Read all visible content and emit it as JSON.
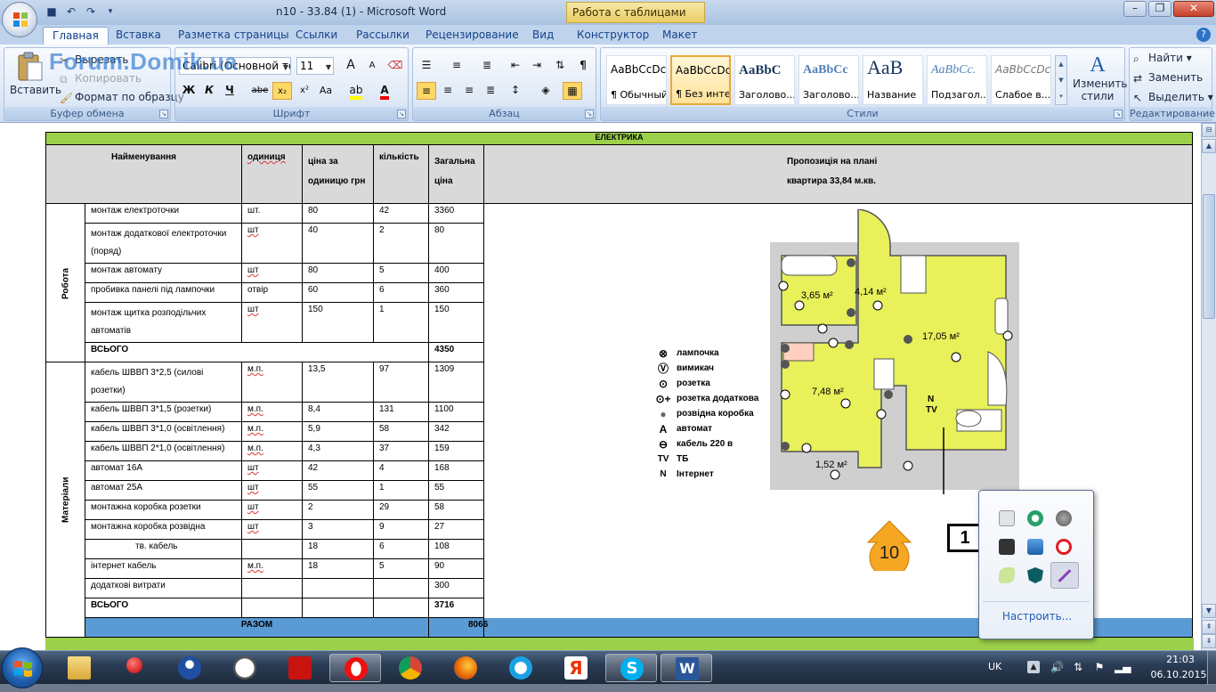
{
  "window": {
    "title": "n10 - 33.84 (1) - Microsoft Word",
    "context_tab": "Работа с таблицами"
  },
  "ribbon_tabs": [
    "Главная",
    "Вставка",
    "Разметка страницы",
    "Ссылки",
    "Рассылки",
    "Рецензирование",
    "Вид",
    "Конструктор",
    "Макет"
  ],
  "clipboard": {
    "paste": "Вставить",
    "cut": "Вырезать",
    "copy": "Копировать",
    "format_painter": "Формат по образцу",
    "group": "Буфер обмена"
  },
  "font": {
    "name": "Calibri (Основной текст)",
    "size": "11",
    "group": "Шрифт",
    "bold": "Ж",
    "italic": "К",
    "underline": "Ч",
    "strike": "abe",
    "subscript": "x₂",
    "superscript": "x²",
    "case": "Aa",
    "grow": "A",
    "shrink": "A"
  },
  "paragraph": {
    "group": "Абзац"
  },
  "styles": {
    "group": "Стили",
    "items": [
      {
        "sample": "AaBbCcDc",
        "name": "¶ Обычный"
      },
      {
        "sample": "AaBbCcDc",
        "name": "¶ Без инте..."
      },
      {
        "sample": "AaBbC",
        "name": "Заголово..."
      },
      {
        "sample": "AaBbCc",
        "name": "Заголово..."
      },
      {
        "sample": "AaB",
        "name": "Название"
      },
      {
        "sample": "AaBbCc.",
        "name": "Подзагол..."
      },
      {
        "sample": "AaBbCcDc",
        "name": "Слабое в..."
      }
    ],
    "change_styles": "Изменить стили"
  },
  "editing": {
    "group": "Редактирование",
    "find": "Найти",
    "replace": "Заменить",
    "select": "Выделить"
  },
  "watermark": "Forum.Domik.ua",
  "document": {
    "section_title": "ЕЛЕКТРИКА",
    "headers": {
      "name": "Найменування",
      "unit": "одиниця",
      "price": "ціна за одиницю грн",
      "qty": "кількість",
      "total": "Загальна ціна",
      "proposal": "Пропозиція на плані квартира 33,84 м.кв."
    },
    "work_label": "Робота",
    "materials_label": "Матеріали",
    "work_rows": [
      {
        "name": "монтаж електроточки",
        "unit": "шт.",
        "price": "80",
        "qty": "42",
        "total": "3360"
      },
      {
        "name": "монтаж додаткової електроточки (поряд)",
        "unit": "шт",
        "price": "40",
        "qty": "2",
        "total": "80"
      },
      {
        "name": "монтаж автомату",
        "unit": "шт",
        "price": "80",
        "qty": "5",
        "total": "400"
      },
      {
        "name": "пробивка панелі під лампочки",
        "unit": "отвір",
        "price": "60",
        "qty": "6",
        "total": "360"
      },
      {
        "name": "монтаж щитка розподільчих автоматів",
        "unit": "шт",
        "price": "150",
        "qty": "1",
        "total": "150"
      }
    ],
    "work_total_label": "ВСЬОГО",
    "work_total": "4350",
    "material_rows": [
      {
        "name": "кабель ШВВП 3*2,5  (силові розетки)",
        "unit": "м.п.",
        "price": "13,5",
        "qty": "97",
        "total": "1309"
      },
      {
        "name": "кабель ШВВП 3*1,5 (розетки)",
        "unit": "м.п.",
        "price": "8,4",
        "qty": "131",
        "total": "1100"
      },
      {
        "name": "кабель ШВВП 3*1,0  (освітлення)",
        "unit": "м.п.",
        "price": "5,9",
        "qty": "58",
        "total": "342"
      },
      {
        "name": "кабель ШВВП 2*1,0 (освітлення)",
        "unit": "м.п.",
        "price": "4,3",
        "qty": "37",
        "total": "159"
      },
      {
        "name": "автомат 16А",
        "unit": "шт",
        "price": "42",
        "qty": "4",
        "total": "168"
      },
      {
        "name": "автомат 25А",
        "unit": "шт",
        "price": "55",
        "qty": "1",
        "total": "55"
      },
      {
        "name": "монтажна коробка розетки",
        "unit": "шт",
        "price": "2",
        "qty": "29",
        "total": "58"
      },
      {
        "name": "монтажна коробка розвідна",
        "unit": "шт",
        "price": "3",
        "qty": "9",
        "total": "27"
      },
      {
        "name": "тв. кабель",
        "unit": "",
        "price": "18",
        "qty": "6",
        "total": "108"
      },
      {
        "name": "інтернет кабель",
        "unit": "м.п.",
        "price": "18",
        "qty": "5",
        "total": "90"
      },
      {
        "name": "додаткові витрати",
        "unit": "",
        "price": "",
        "qty": "",
        "total": "300"
      }
    ],
    "materials_total_label": "ВСЬОГО",
    "materials_total": "3716",
    "grand_label": "РАЗОМ",
    "grand_total": "8066"
  },
  "plan": {
    "rooms": [
      "3,65 м²",
      "4,14 м²",
      "17,05 м²",
      "7,48 м²",
      "1,52 м²"
    ],
    "marks": {
      "n": "N",
      "tv": "TV"
    },
    "apartment_number": "10",
    "floor_number": "1"
  },
  "legend": [
    {
      "symbol": "⊗",
      "label": "лампочка"
    },
    {
      "symbol": "Ⓥ",
      "label": "вимикач"
    },
    {
      "symbol": "⊙",
      "label": "розетка"
    },
    {
      "symbol": "⊙+",
      "label": "розетка додаткова"
    },
    {
      "symbol": "●",
      "label": "розвідна коробка"
    },
    {
      "symbol": "A",
      "label": "автомат"
    },
    {
      "symbol": "⊖",
      "label": "кабель 220 в"
    },
    {
      "symbol": "TV",
      "label": "ТБ"
    },
    {
      "symbol": "N",
      "label": "Інтернет"
    }
  ],
  "tray_popup": {
    "configure": "Настроить..."
  },
  "taskbar": {
    "lang": "UK",
    "time": "21:03",
    "date": "06.10.2015"
  },
  "colors": {
    "accent_green": "#9bd04a",
    "total_blue": "#5b9bd5",
    "header_grey": "#d9d9d9",
    "plan_yellow": "#e8f05a"
  }
}
